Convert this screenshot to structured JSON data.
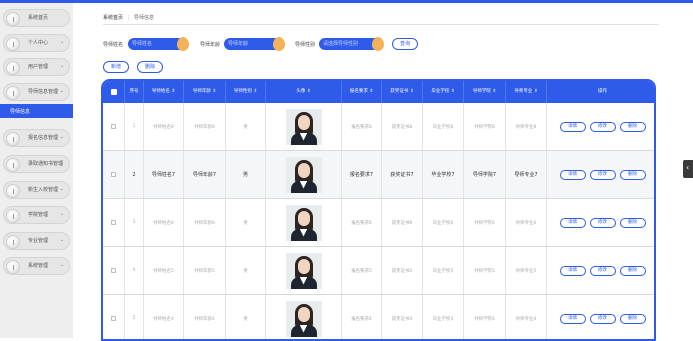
{
  "sidebar": {
    "items": [
      {
        "label": "系统首页",
        "chevron": ""
      },
      {
        "label": "个人中心",
        "chevron": "⌄"
      },
      {
        "label": "用户管理",
        "chevron": "⌄"
      },
      {
        "label": "导师信息管理",
        "chevron": "⌄"
      },
      {
        "label": "报名信息管理",
        "chevron": "⌄"
      },
      {
        "label": "录取通知书管理",
        "chevron": "⌄"
      },
      {
        "label": "新生入校管理",
        "chevron": "⌄"
      },
      {
        "label": "学院管理",
        "chevron": "⌄"
      },
      {
        "label": "专业管理",
        "chevron": "⌄"
      },
      {
        "label": "系统管理",
        "chevron": "⌄"
      }
    ],
    "active_sub": "导师信息"
  },
  "breadcrumb": {
    "home": "系统首页",
    "sep": "⋮",
    "current": "导师信息"
  },
  "filters": {
    "name_label": "导师姓名",
    "name_placeholder": "导师姓名",
    "gonghao_label": "导师年龄",
    "gonghao_placeholder": "导师年龄",
    "gender_label": "导师性别",
    "gender_placeholder": "请选择导师性别",
    "search_btn": "查询"
  },
  "actions": {
    "add": "新增",
    "delete": "删除"
  },
  "table": {
    "headers": [
      "",
      "序号",
      "导师姓名 ⇕",
      "导师年龄 ⇕",
      "导师性别 ⇕",
      "头像 ⇕",
      "报名要求 ⇕",
      "获奖证书 ⇕",
      "毕业学校 ⇕",
      "导师学院 ⇕",
      "导师专业 ⇕",
      "操作"
    ],
    "row_buttons": {
      "detail": "详情",
      "edit": "修改",
      "delete": "删除"
    },
    "rows": [
      {
        "no": "1",
        "name": "导师姓名8",
        "age": "导师年龄8",
        "gender": "男",
        "req": "报名要求8",
        "cert": "获奖证书8",
        "school": "毕业学校8",
        "college": "导师学院8",
        "major": "导师专业8"
      },
      {
        "no": "2",
        "name": "导师姓名7",
        "age": "导师年龄7",
        "gender": "男",
        "req": "报名要求7",
        "cert": "获奖证书7",
        "school": "毕业学校7",
        "college": "导师学院7",
        "major": "导师专业7"
      },
      {
        "no": "3",
        "name": "导师姓名6",
        "age": "导师年龄6",
        "gender": "男",
        "req": "报名要求6",
        "cert": "获奖证书6",
        "school": "毕业学校6",
        "college": "导师学院6",
        "major": "导师专业6"
      },
      {
        "no": "4",
        "name": "导师姓名5",
        "age": "导师年龄5",
        "gender": "男",
        "req": "报名要求5",
        "cert": "获奖证书5",
        "school": "毕业学校5",
        "college": "导师学院5",
        "major": "导师专业5"
      },
      {
        "no": "5",
        "name": "导师姓名4",
        "age": "导师年龄4",
        "gender": "男",
        "req": "报名要求4",
        "cert": "获奖证书4",
        "school": "毕业学校4",
        "college": "导师学院4",
        "major": "导师专业4"
      }
    ]
  },
  "colors": {
    "primary": "#2f5bea",
    "accent_drop": "#f1b25a"
  }
}
